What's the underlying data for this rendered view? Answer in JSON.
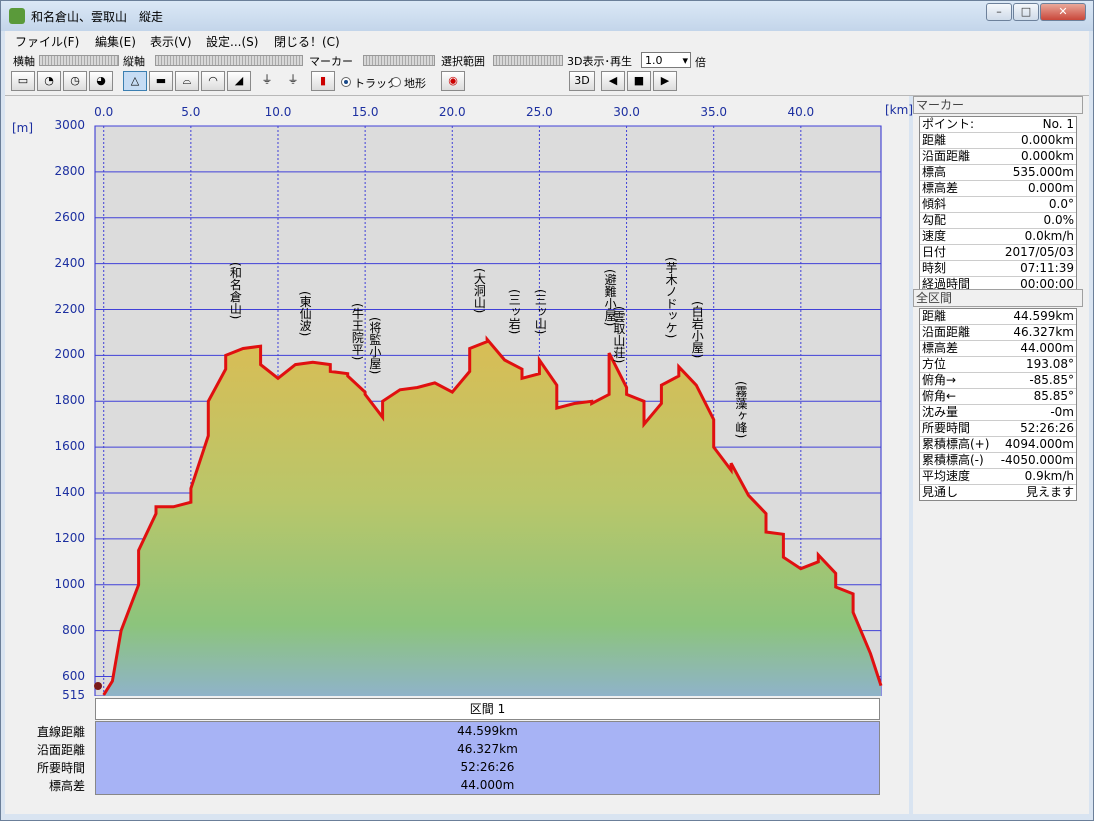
{
  "window": {
    "title": "和名倉山、雲取山　縦走"
  },
  "menu": [
    "ファイル(F)",
    "編集(E)",
    "表示(V)",
    "設定...(S)",
    "閉じる！(C)"
  ],
  "toolbar": {
    "haxis_label": "横軸",
    "vaxis_label": "縦軸",
    "marker_label": "マーカー",
    "range_label": "選択範囲",
    "play_label": "3D表示･再生",
    "speed_value": "1.0",
    "speed_unit": "倍",
    "track_label": "トラック",
    "terrain_label": "地形"
  },
  "chart_data": {
    "type": "area",
    "x_unit": "[km]",
    "y_unit": "[m]",
    "xlim": [
      -0.5,
      44.6
    ],
    "ylim": [
      515,
      3000
    ],
    "x_ticks": [
      "0.0",
      "5.0",
      "10.0",
      "15.0",
      "20.0",
      "25.0",
      "30.0",
      "35.0",
      "40.0"
    ],
    "y_ticks": [
      "3000",
      "2800",
      "2600",
      "2400",
      "2200",
      "2000",
      "1800",
      "1600",
      "1400",
      "1200",
      "1000",
      "800",
      "600",
      "515"
    ],
    "grid": true,
    "line_color": "#e01010",
    "x": [
      0,
      0.5,
      1,
      2,
      2,
      3,
      3,
      4,
      5,
      5,
      6,
      6,
      7,
      7,
      8,
      9,
      9,
      10,
      11,
      11,
      12,
      12,
      13,
      13,
      14,
      14,
      15,
      15,
      16,
      16,
      17,
      18,
      19,
      20,
      20,
      21,
      21,
      22,
      22,
      23,
      24,
      24,
      25,
      25,
      26,
      26,
      27,
      28,
      28,
      29,
      29,
      30,
      30,
      31,
      31,
      32,
      32,
      33,
      33,
      34,
      35,
      35,
      36,
      36,
      37,
      38,
      38,
      39,
      39,
      40,
      41,
      41,
      42,
      42,
      43,
      43,
      44,
      44.6
    ],
    "y": [
      520,
      580,
      800,
      1000,
      1150,
      1310,
      1340,
      1340,
      1360,
      1420,
      1650,
      1800,
      1940,
      2000,
      2030,
      2040,
      1960,
      1900,
      1960,
      1960,
      1970,
      1970,
      1960,
      1930,
      1920,
      1910,
      1840,
      1830,
      1730,
      1800,
      1850,
      1860,
      1880,
      1840,
      1840,
      1930,
      2030,
      2060,
      2070,
      1980,
      1940,
      1900,
      1920,
      1980,
      1870,
      1770,
      1790,
      1800,
      1790,
      1830,
      2010,
      1860,
      1830,
      1800,
      1700,
      1790,
      1870,
      1910,
      1950,
      1870,
      1720,
      1600,
      1500,
      1530,
      1390,
      1310,
      1230,
      1220,
      1120,
      1070,
      1100,
      1130,
      1050,
      990,
      960,
      880,
      700,
      560
    ],
    "peaks": [
      {
        "label": "(和名倉山)",
        "x": 7.5,
        "y": 2040
      },
      {
        "label": "(東仙波)",
        "x": 11.5,
        "y": 1970
      },
      {
        "label": "(牛王院平)",
        "x": 14.5,
        "y": 1860
      },
      {
        "label": "(将監小屋)",
        "x": 15.5,
        "y": 1800
      },
      {
        "label": "(大洞山)",
        "x": 21.5,
        "y": 2070
      },
      {
        "label": "(三ッ岩)",
        "x": 23.5,
        "y": 1980
      },
      {
        "label": "(三ッ山)",
        "x": 25.0,
        "y": 1980
      },
      {
        "label": "(避難小屋)",
        "x": 29.0,
        "y": 2010
      },
      {
        "label": "(雲取山荘)",
        "x": 29.5,
        "y": 1850
      },
      {
        "label": "(芋木ノドッケ)",
        "x": 32.5,
        "y": 1950
      },
      {
        "label": "(白岩小屋)",
        "x": 34.0,
        "y": 1870
      },
      {
        "label": "(霧藻ヶ峰)",
        "x": 36.5,
        "y": 1520
      }
    ]
  },
  "section": {
    "header": "区間 1",
    "labels": [
      "直線距離",
      "沿面距離",
      "所要時間",
      "標高差"
    ],
    "values": [
      "44.599km",
      "46.327km",
      "52:26:26",
      "44.000m"
    ]
  },
  "marker_panel": {
    "title": "マーカー",
    "rows": [
      [
        "ポイント:",
        "No. 1"
      ],
      [
        "距離",
        "0.000km"
      ],
      [
        "沿面距離",
        "0.000km"
      ],
      [
        "標高",
        "535.000m"
      ],
      [
        "標高差",
        "0.000m"
      ],
      [
        "傾斜",
        "0.0°"
      ],
      [
        "勾配",
        "0.0%"
      ],
      [
        "速度",
        "0.0km/h"
      ],
      [
        "日付",
        "2017/05/03"
      ],
      [
        "時刻",
        "07:11:39"
      ],
      [
        "経過時間",
        "00:00:00"
      ]
    ]
  },
  "total_panel": {
    "title": "全区間",
    "rows": [
      [
        "距離",
        "44.599km"
      ],
      [
        "沿面距離",
        "46.327km"
      ],
      [
        "標高差",
        "44.000m"
      ],
      [
        "方位",
        "193.08°"
      ],
      [
        "俯角→",
        "-85.85°"
      ],
      [
        "俯角←",
        "85.85°"
      ],
      [
        "沈み量",
        "-0m"
      ],
      [
        "所要時間",
        "52:26:26"
      ],
      [
        "累積標高(+)",
        "4094.000m"
      ],
      [
        "累積標高(-)",
        "-4050.000m"
      ],
      [
        "平均速度",
        "0.9km/h"
      ],
      [
        "見通し",
        "見えます"
      ]
    ]
  }
}
